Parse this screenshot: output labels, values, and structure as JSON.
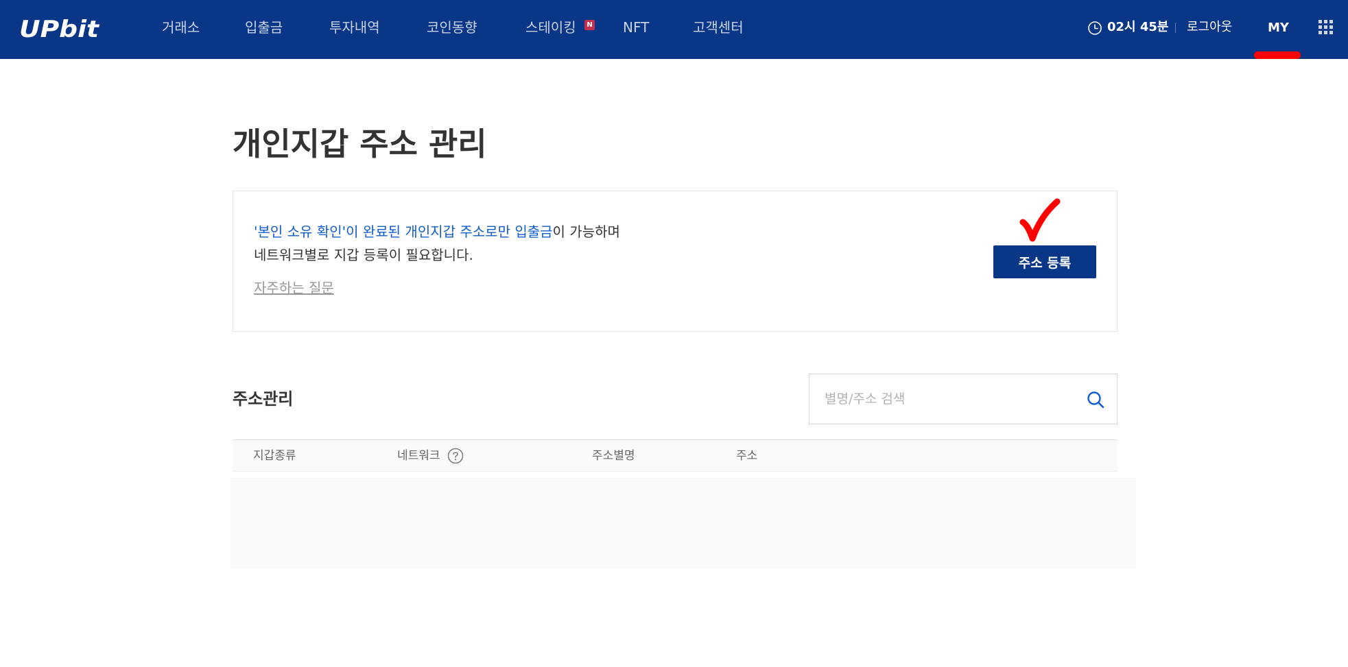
{
  "header": {
    "logo_text": "UPbit",
    "nav": [
      {
        "label": "거래소"
      },
      {
        "label": "입출금"
      },
      {
        "label": "투자내역"
      },
      {
        "label": "코인동향"
      },
      {
        "label": "스테이킹"
      },
      {
        "label": "NFT"
      },
      {
        "label": "고객센터"
      }
    ],
    "staking_badge": "N",
    "clock": "02시 45분",
    "logout": "로그아웃",
    "my": "MY"
  },
  "page": {
    "title": "개인지갑 주소 관리"
  },
  "info": {
    "line1_highlight": "'본인 소유 확인'이 완료된 개인지갑 주소로만 입출금",
    "line1_rest": "이 가능하며",
    "line2": "네트워크별로 지갑 등록이 필요합니다.",
    "faq": "자주하는 질문",
    "register_button": "주소 등록"
  },
  "section": {
    "title": "주소관리",
    "search_placeholder": "별명/주소 검색"
  },
  "table": {
    "columns": [
      {
        "label": "지갑종류"
      },
      {
        "label": "네트워크"
      },
      {
        "label": "주소별명"
      },
      {
        "label": "주소"
      }
    ],
    "rows": []
  },
  "colors": {
    "brand": "#093687",
    "link_blue": "#115dcb",
    "annotation_red": "#ff0000",
    "badge": "#c42f4e"
  },
  "icons": {
    "clock": "clock-icon",
    "apps": "apps-grid-icon",
    "search": "search-icon",
    "help": "question-circle-icon",
    "annotation": "red-checkmark-icon"
  }
}
